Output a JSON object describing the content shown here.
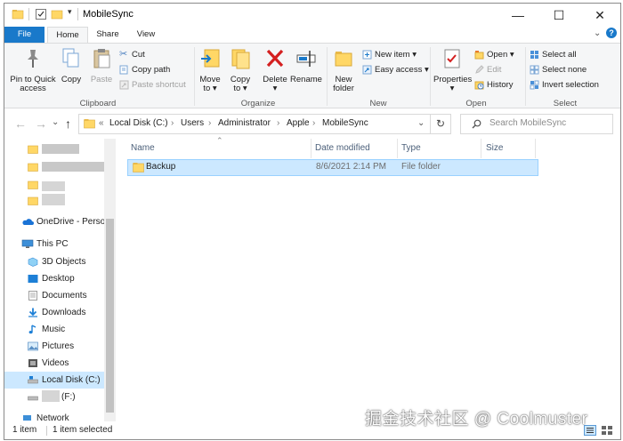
{
  "window": {
    "title": "MobileSync",
    "minimize": "—",
    "maximize": "☐",
    "close": "✕"
  },
  "tabs": {
    "file": "File",
    "home": "Home",
    "share": "Share",
    "view": "View"
  },
  "ribbon": {
    "clipboard": {
      "pin": [
        "Pin to Quick",
        "access"
      ],
      "copy": "Copy",
      "paste": "Paste",
      "cut": "Cut",
      "copy_path": "Copy path",
      "paste_shortcut": "Paste shortcut",
      "label": "Clipboard"
    },
    "organize": {
      "move_to": [
        "Move",
        "to ▾"
      ],
      "copy_to": [
        "Copy",
        "to ▾"
      ],
      "delete": [
        "Delete",
        "▾"
      ],
      "rename": "Rename",
      "label": "Organize"
    },
    "new": {
      "new_folder": [
        "New",
        "folder"
      ],
      "new_item": "New item ▾",
      "easy_access": "Easy access ▾",
      "label": "New"
    },
    "open": {
      "properties": [
        "Properties",
        "▾"
      ],
      "open": "Open ▾",
      "edit": "Edit",
      "history": "History",
      "label": "Open"
    },
    "select": {
      "select_all": "Select all",
      "select_none": "Select none",
      "invert": "Invert selection",
      "label": "Select"
    }
  },
  "address": {
    "back": "←",
    "forward": "→",
    "recent": "⌄",
    "up": "↑",
    "overflow": "«",
    "crumbs": [
      "Local Disk (C:)",
      "Users",
      "Administrator",
      "Apple",
      "MobileSync"
    ],
    "separator": "›",
    "refresh": "↻",
    "search_placeholder": "Search MobileSync"
  },
  "navpane": {
    "items": [
      {
        "label": "OneDrive - Person",
        "icon": "onedrive-icon"
      },
      {
        "label": "This PC",
        "icon": "this-pc-icon"
      },
      {
        "label": "3D Objects",
        "icon": "3d-objects-icon"
      },
      {
        "label": "Desktop",
        "icon": "desktop-icon"
      },
      {
        "label": "Documents",
        "icon": "documents-icon"
      },
      {
        "label": "Downloads",
        "icon": "downloads-icon"
      },
      {
        "label": "Music",
        "icon": "music-icon"
      },
      {
        "label": "Pictures",
        "icon": "pictures-icon"
      },
      {
        "label": "Videos",
        "icon": "videos-icon"
      },
      {
        "label": "Local Disk (C:)",
        "icon": "local-disk-icon"
      },
      {
        "label": "(F:)",
        "icon": "drive-icon"
      },
      {
        "label": "Network",
        "icon": "network-icon"
      }
    ]
  },
  "columns": {
    "name": "Name",
    "date": "Date modified",
    "type": "Type",
    "size": "Size"
  },
  "files": [
    {
      "name": "Backup",
      "date": "8/6/2021 2:14 PM",
      "type": "File folder",
      "size": ""
    }
  ],
  "status": {
    "count": "1 item",
    "selected": "1 item selected"
  },
  "watermark": "掘金技术社区 @ Coolmuster",
  "colors": {
    "accent": "#1979ca",
    "selection": "#cce8ff",
    "folder": "#ffd766"
  }
}
